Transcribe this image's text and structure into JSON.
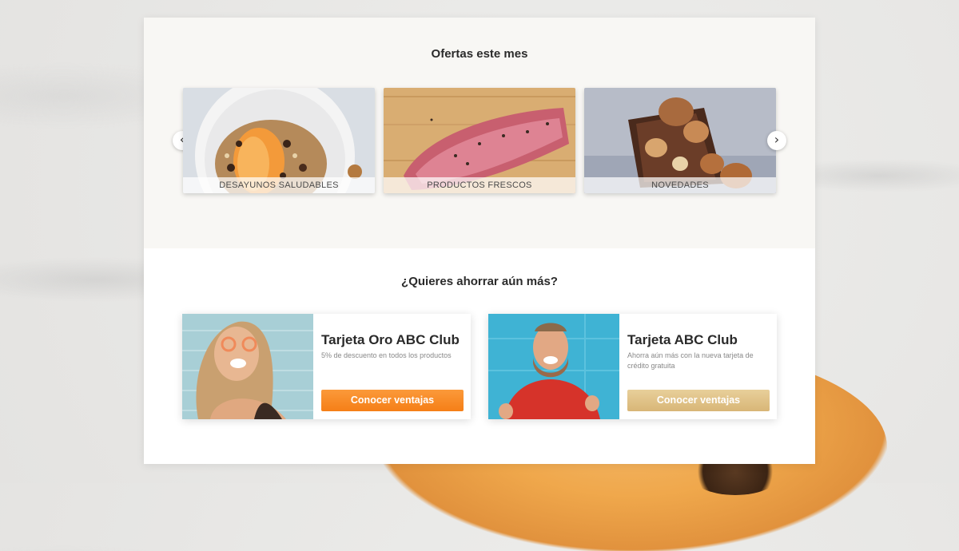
{
  "offers": {
    "title": "Ofertas este mes",
    "tiles": [
      {
        "label": "DESAYUNOS SALUDABLES"
      },
      {
        "label": "PRODUCTOS FRESCOS"
      },
      {
        "label": "NOVEDADES"
      }
    ],
    "prev_icon": "‹",
    "next_icon": "›"
  },
  "savings": {
    "title": "¿Quieres ahorrar aún más?",
    "cards": [
      {
        "title": "Tarjeta Oro ABC Club",
        "description": "5% de descuento en todos los productos",
        "button": "Conocer ventajas",
        "button_color": "#f7871f"
      },
      {
        "title": "Tarjeta ABC Club",
        "description": "Ahorra aún más con la nueva tarjeta de crédito gratuita",
        "button": "Conocer ventajas",
        "button_color": "#dfc085"
      }
    ]
  }
}
